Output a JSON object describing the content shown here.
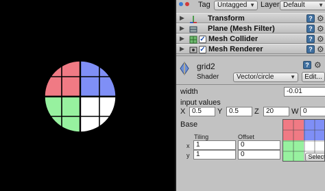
{
  "header": {
    "tag_label": "Tag",
    "tag_value": "Untagged",
    "layer_label": "Layer",
    "layer_value": "Default"
  },
  "components": [
    {
      "name": "Transform",
      "has_checkbox": false
    },
    {
      "name": "Plane (Mesh Filter)",
      "has_checkbox": false
    },
    {
      "name": "Mesh Collider",
      "has_checkbox": true,
      "checked": true
    },
    {
      "name": "Mesh Renderer",
      "has_checkbox": true,
      "checked": true
    }
  ],
  "material": {
    "name": "grid2",
    "shader_label": "Shader",
    "shader_value": "Vector/circle",
    "edit_label": "Edit..."
  },
  "props": {
    "width_label": "width",
    "width_value": "-0.01",
    "input_values_label": "input values",
    "x_label": "X",
    "x_value": "0.5",
    "y_label": "Y",
    "y_value": "0.5",
    "z_label": "Z",
    "z_value": "20",
    "w_label": "W",
    "w_value": "0",
    "base_label": "Base",
    "tiling_label": "Tiling",
    "offset_label": "Offset",
    "tile_x_label": "x",
    "tile_x_value": "1",
    "offset_x_value": "0",
    "tile_y_label": "y",
    "tile_y_value": "1",
    "offset_y_value": "0",
    "select_label": "Select"
  },
  "texture_quadrants": {
    "top_left": "#f07a84",
    "top_right": "#7f8ff6",
    "bottom_left": "#97f19f",
    "bottom_right": "#ffffff"
  }
}
